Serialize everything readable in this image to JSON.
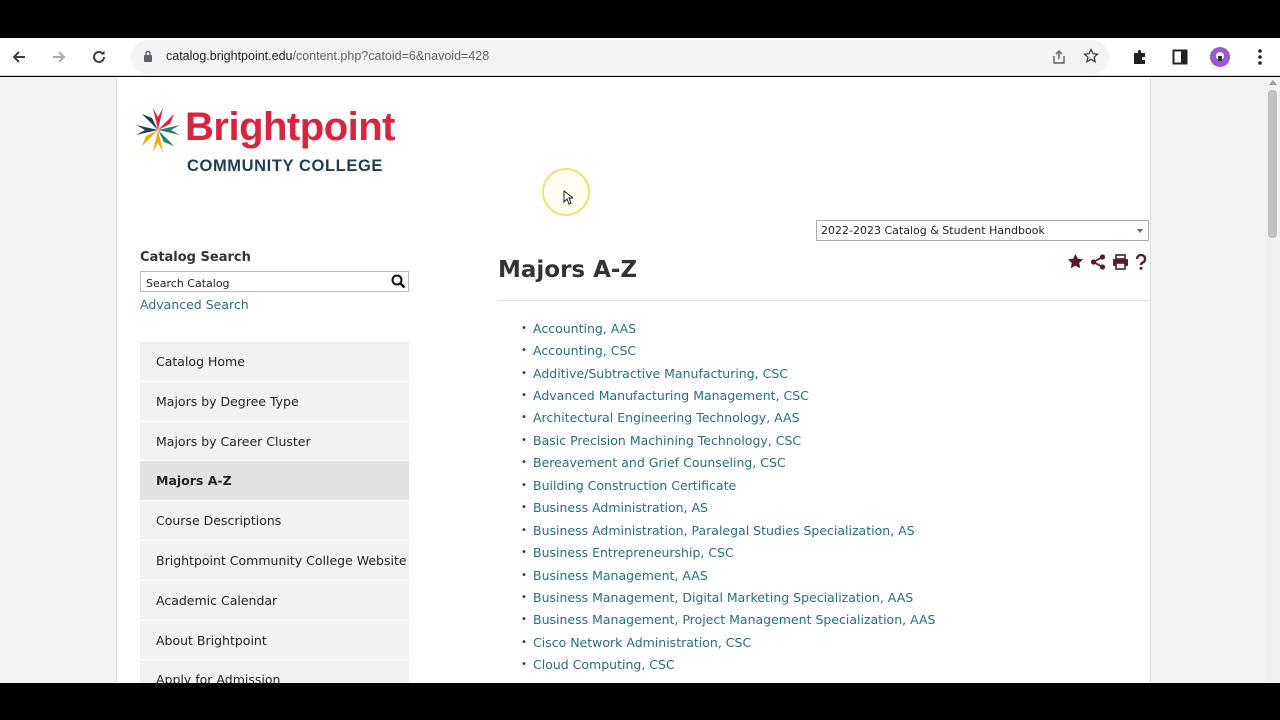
{
  "browser": {
    "url_domain": "catalog.brightpoint.edu",
    "url_path": "/content.php?catoid=6&navoid=428",
    "profile_color": "#9b59d0"
  },
  "logo": {
    "brand": "Brightpoint",
    "subtitle": "COMMUNITY COLLEGE"
  },
  "catalog_select": {
    "selected": "2022-2023 Catalog & Student Handbook"
  },
  "sidebar": {
    "search_label": "Catalog Search",
    "search_placeholder": "Search Catalog",
    "advanced_search": "Advanced Search",
    "items": [
      {
        "label": "Catalog Home"
      },
      {
        "label": "Majors by Degree Type"
      },
      {
        "label": "Majors by Career Cluster"
      },
      {
        "label": "Majors A-Z",
        "active": true
      },
      {
        "label": "Course Descriptions"
      },
      {
        "label": "Brightpoint Community College Website"
      },
      {
        "label": "Academic Calendar"
      },
      {
        "label": "About Brightpoint"
      },
      {
        "label": "Apply for Admission"
      }
    ]
  },
  "main": {
    "title": "Majors A-Z",
    "majors": [
      "Accounting, AAS",
      "Accounting, CSC",
      "Additive/Subtractive Manufacturing, CSC",
      "Advanced Manufacturing Management, CSC",
      "Architectural Engineering Technology, AAS",
      "Basic Precision Machining Technology, CSC",
      "Bereavement and Grief Counseling, CSC",
      "Building Construction Certificate",
      "Business Administration, AS",
      "Business Administration, Paralegal Studies Specialization, AS",
      "Business Entrepreneurship, CSC",
      "Business Management, AAS",
      "Business Management, Digital Marketing Specialization, AAS",
      "Business Management, Project Management Specialization, AAS",
      "Cisco Network Administration, CSC",
      "Cloud Computing, CSC"
    ]
  },
  "colors": {
    "brand_red": "#d7243f",
    "brand_navy": "#1f3f4f",
    "link_teal": "#2a6e7a",
    "icon_maroon": "#5a1a2e"
  }
}
